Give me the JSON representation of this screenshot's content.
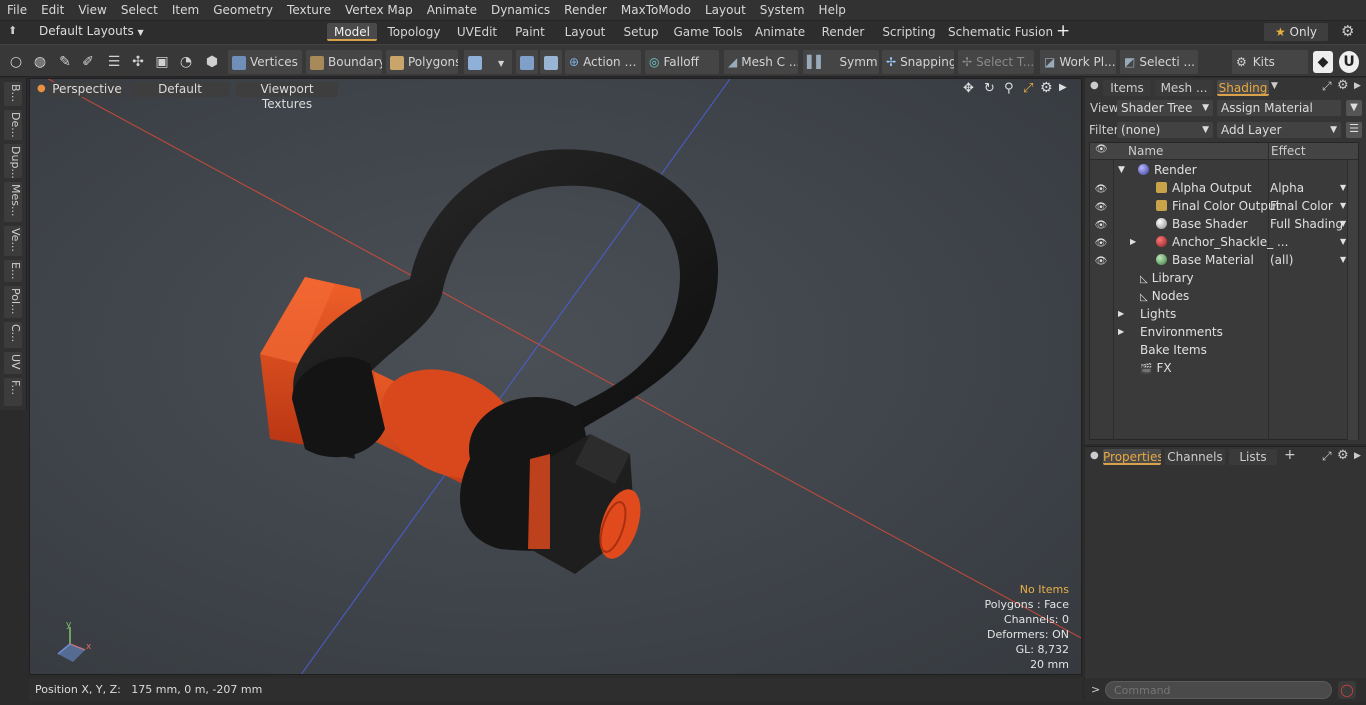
{
  "menu": [
    "File",
    "Edit",
    "View",
    "Select",
    "Item",
    "Geometry",
    "Texture",
    "Vertex Map",
    "Animate",
    "Dynamics",
    "Render",
    "MaxToModo",
    "Layout",
    "System",
    "Help"
  ],
  "layout_selector": "Default Layouts",
  "layout_tabs": [
    "Model",
    "Topology",
    "UVEdit",
    "Paint",
    "Layout",
    "Setup",
    "Game Tools",
    "Animate",
    "Render",
    "Scripting",
    "Schematic Fusion"
  ],
  "only_button": "Only",
  "toolbar": {
    "vertices": "Vertices",
    "boundary": "Boundary",
    "polygons": "Polygons",
    "action": "Action",
    "falloff": "Falloff",
    "mesh": "Mesh C ...",
    "symm": "Symm ...",
    "snapping": "Snapping",
    "select_t": "Select T...",
    "work_pl": "Work Pl...",
    "selecti": "Selecti ...",
    "kits": "Kits"
  },
  "left_tabs": [
    "B...",
    "De...",
    "Dup...",
    "Mes...",
    "Ve...",
    "E...",
    "Pol...",
    "C...",
    "UV",
    "F..."
  ],
  "viewport": {
    "perspective": "Perspective",
    "default": "Default",
    "textures": "Viewport Textures",
    "stats": {
      "no_items": "No Items",
      "polygons": "Polygons : Face",
      "channels": "Channels: 0",
      "deformers": "Deformers: ON",
      "gl": "GL: 8,732",
      "scale": "20 mm"
    }
  },
  "status": {
    "position": "Position X, Y, Z:   175 mm, 0 m, -207 mm"
  },
  "right_panel": {
    "tabs": [
      "Items",
      "Mesh ...",
      "Shading"
    ],
    "view_label": "View",
    "view_value": "Shader Tree",
    "assign_material": "Assign Material",
    "filter_label": "Filter",
    "filter_value": "(none)",
    "add_layer": "Add Layer",
    "col_name": "Name",
    "col_effect": "Effect",
    "tree": [
      {
        "name": "Render",
        "effect": "",
        "eye": false
      },
      {
        "name": "Alpha Output",
        "effect": "Alpha",
        "eye": true
      },
      {
        "name": "Final Color Output",
        "effect": "Final Color",
        "eye": true
      },
      {
        "name": "Base Shader",
        "effect": "Full Shading",
        "eye": true
      },
      {
        "name": "Anchor_Shackle_ ...",
        "effect": "",
        "eye": true
      },
      {
        "name": "Base Material",
        "effect": "(all)",
        "eye": true
      },
      {
        "name": "Library",
        "effect": "",
        "eye": false
      },
      {
        "name": "Nodes",
        "effect": "",
        "eye": false
      },
      {
        "name": "Lights",
        "effect": "",
        "eye": false
      },
      {
        "name": "Environments",
        "effect": "",
        "eye": false
      },
      {
        "name": "Bake Items",
        "effect": "",
        "eye": false
      },
      {
        "name": "FX",
        "effect": "",
        "eye": false
      }
    ]
  },
  "lower_panel": {
    "tabs": [
      "Properties",
      "Channels",
      "Lists"
    ]
  },
  "command": {
    "placeholder": "Command"
  },
  "colors": {
    "accent": "#d8a14a",
    "shackle_orange": "#e04a1c",
    "shackle_black": "#1a1a1a"
  }
}
